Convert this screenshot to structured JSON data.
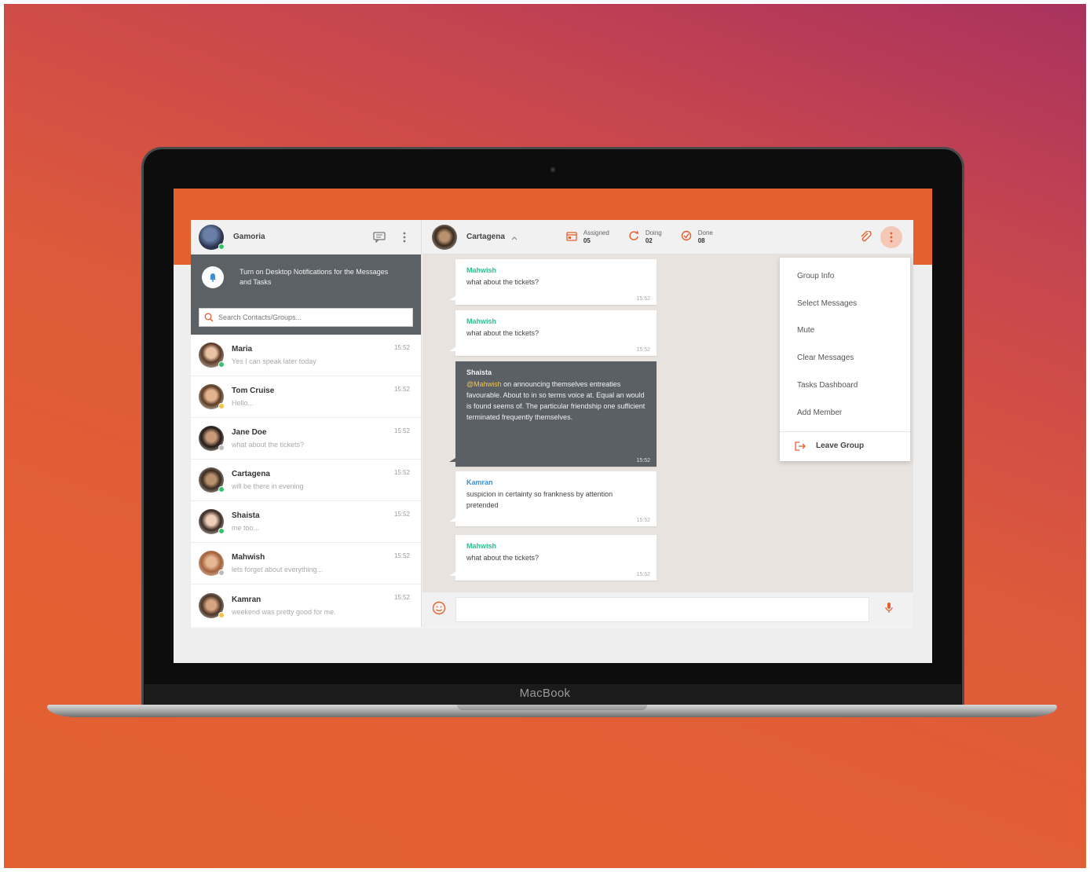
{
  "device": {
    "brand": "MacBook"
  },
  "sidebar": {
    "user_name": "Gamoria",
    "notification": "Turn on Desktop Notifications for the Messages and Tasks",
    "search_placeholder": "Search Contacts/Groups...",
    "contacts": [
      {
        "name": "Maria",
        "message": "Yes I can speak later today",
        "time": "15:52",
        "status": "online"
      },
      {
        "name": "Tom Cruise",
        "message": "Hello...",
        "time": "15:52",
        "status": "away"
      },
      {
        "name": "Jane Doe",
        "message": "what about the tickets?",
        "time": "15:52",
        "status": "offline"
      },
      {
        "name": "Cartagena",
        "message": "will be there in evening",
        "time": "15:52",
        "status": "online"
      },
      {
        "name": "Shaista",
        "message": "me too...",
        "time": "15:52",
        "status": "online"
      },
      {
        "name": "Mahwish",
        "message": "lets forget about everything...",
        "time": "15:52",
        "status": "offline"
      },
      {
        "name": "Kamran",
        "message": "weekend was pretty good for me.",
        "time": "15:52",
        "status": "away"
      }
    ]
  },
  "chat": {
    "title": "Cartagena",
    "stats": [
      {
        "label": "Assigned",
        "value": "05",
        "icon": "calendar-icon"
      },
      {
        "label": "Doing",
        "value": "02",
        "icon": "refresh-icon"
      },
      {
        "label": "Done",
        "value": "08",
        "icon": "check-circle-icon"
      }
    ],
    "messages": [
      {
        "sender": "Mahwish",
        "text": "what about the tickets?",
        "time": "15:52",
        "dark": false,
        "color": "#2bbf8a"
      },
      {
        "sender": "Mahwish",
        "text": "what about the tickets?",
        "time": "15:52",
        "dark": false,
        "color": "#2bbf8a"
      },
      {
        "sender": "Shaista",
        "mention": "@Mahwish",
        "text": " on announcing themselves entreaties favourable. About to in so terms voice at. Equal an would is found seems of. The particular friendship one sufficient terminated frequently themselves.",
        "time": "15:52",
        "dark": true
      },
      {
        "sender": "Kamran",
        "text": "suspicion in certainty so frankness by attention pretended",
        "time": "15:52",
        "dark": false,
        "color": "#3b8fd6"
      },
      {
        "sender": "Mahwish",
        "text": "what about the tickets?",
        "time": "15:52",
        "dark": false,
        "color": "#2bbf8a"
      }
    ]
  },
  "menu": {
    "items": [
      "Group Info",
      "Select Messages",
      "Mute",
      "Clear Messages",
      "Tasks Dashboard",
      "Add Member"
    ],
    "leave": "Leave Group"
  },
  "colors": {
    "accent": "#e4602f",
    "online": "#33c46a",
    "away": "#f5c242",
    "offline": "#bbbbbb"
  }
}
